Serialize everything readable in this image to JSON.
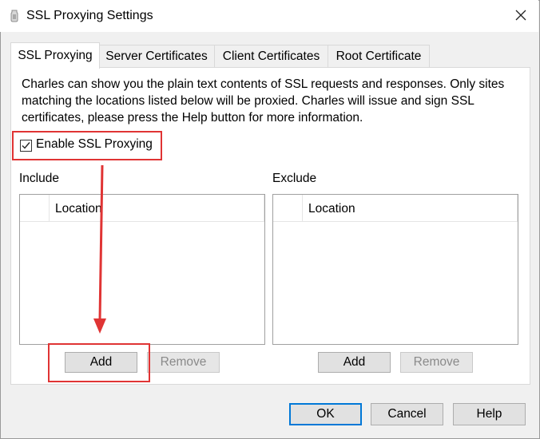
{
  "window": {
    "title": "SSL Proxying Settings",
    "app_icon": "charles-jug-icon",
    "close_icon": "close-icon"
  },
  "tabs": [
    {
      "label": "SSL Proxying",
      "active": true
    },
    {
      "label": "Server Certificates",
      "active": false
    },
    {
      "label": "Client Certificates",
      "active": false
    },
    {
      "label": "Root Certificate",
      "active": false
    }
  ],
  "ssl_proxying": {
    "description": "Charles can show you the plain text contents of SSL requests and responses. Only sites matching the locations listed below will be proxied. Charles will issue and sign SSL certificates, please press the Help button for more information.",
    "enable_checkbox": {
      "label": "Enable SSL Proxying",
      "checked": true
    },
    "include": {
      "label": "Include",
      "column_header": "Location",
      "rows": [],
      "add_label": "Add",
      "remove_label": "Remove"
    },
    "exclude": {
      "label": "Exclude",
      "column_header": "Location",
      "rows": [],
      "add_label": "Add",
      "remove_label": "Remove"
    }
  },
  "footer": {
    "ok_label": "OK",
    "cancel_label": "Cancel",
    "help_label": "Help"
  },
  "annotations": {
    "color": "#e03434"
  }
}
